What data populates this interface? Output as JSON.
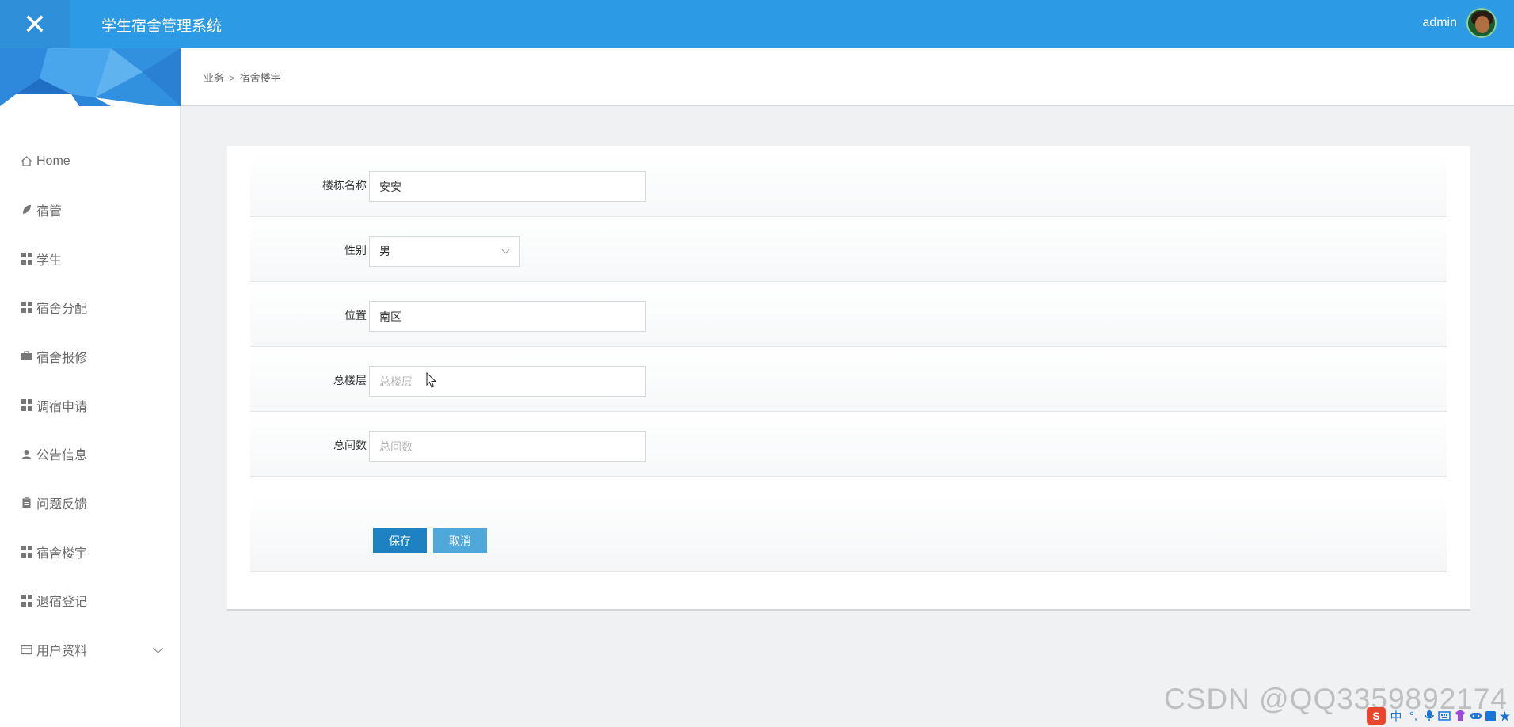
{
  "topbar": {
    "app_title": "学生宿舍管理系统",
    "user_name": "admin",
    "close_glyph": "✕"
  },
  "breadcrumb": {
    "parent": "业务",
    "separator": ">",
    "current": "宿舍楼宇"
  },
  "sidebar": {
    "items": [
      {
        "label": "Home",
        "icon": "home-icon"
      },
      {
        "label": "宿管",
        "icon": "leaf-icon"
      },
      {
        "label": "学生",
        "icon": "grid-icon"
      },
      {
        "label": "宿舍分配",
        "icon": "grid-icon"
      },
      {
        "label": "宿舍报修",
        "icon": "briefcase-icon"
      },
      {
        "label": "调宿申请",
        "icon": "grid-icon"
      },
      {
        "label": "公告信息",
        "icon": "user-icon"
      },
      {
        "label": "问题反馈",
        "icon": "clipboard-icon"
      },
      {
        "label": "宿舍楼宇",
        "icon": "grid-icon"
      },
      {
        "label": "退宿登记",
        "icon": "grid-icon"
      },
      {
        "label": "用户资料",
        "icon": "card-icon",
        "has_submenu": true
      }
    ]
  },
  "form": {
    "fields": {
      "building_name": {
        "label": "楼栋名称",
        "value": "安安",
        "placeholder": ""
      },
      "gender": {
        "label": "性别",
        "value": "男"
      },
      "location": {
        "label": "位置",
        "value": "南区",
        "placeholder": ""
      },
      "total_floors": {
        "label": "总楼层",
        "value": "",
        "placeholder": "总楼层"
      },
      "total_rooms": {
        "label": "总间数",
        "value": "",
        "placeholder": "总间数"
      }
    },
    "save_label": "保存",
    "cancel_label": "取消"
  },
  "watermark": "CSDN @QQ3359892174",
  "ime": {
    "logo": "S",
    "lang": "中",
    "punct": "°,"
  },
  "colors": {
    "topbar": "#2d9ae6",
    "save_button": "#1e82c2",
    "cancel_button": "#4fa8d9",
    "page_background": "#eff1f2"
  }
}
